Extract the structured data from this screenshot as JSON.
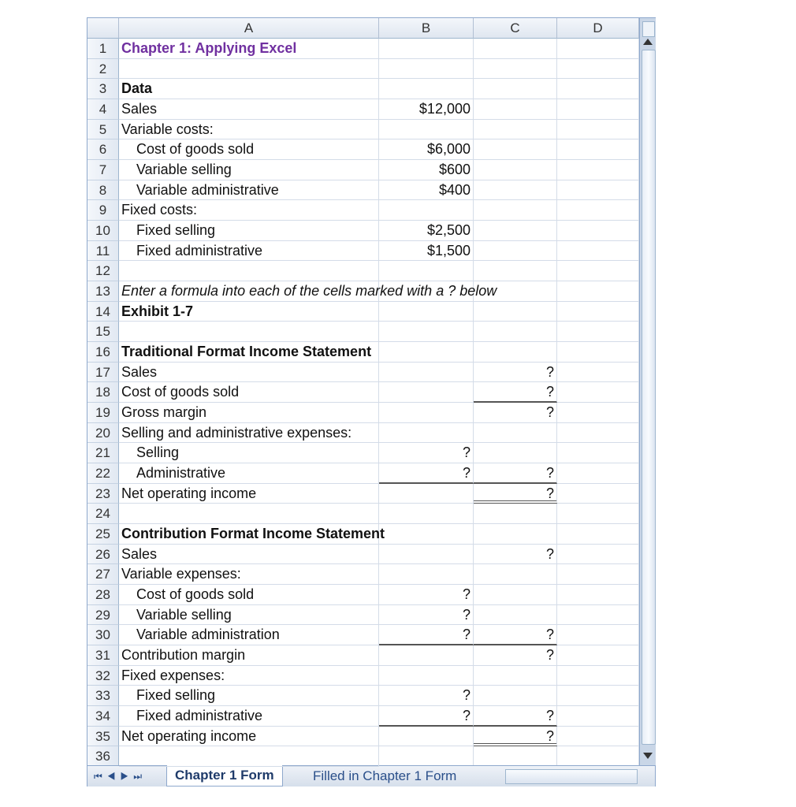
{
  "columns": [
    "A",
    "B",
    "C",
    "D"
  ],
  "rows": [
    {
      "a": "Chapter 1: Applying Excel"
    },
    {},
    {
      "a": "Data"
    },
    {
      "a": "Sales",
      "b": "$12,000"
    },
    {
      "a": "Variable costs:"
    },
    {
      "a": "Cost of goods sold",
      "b": "$6,000"
    },
    {
      "a": "Variable selling",
      "b": "$600"
    },
    {
      "a": "Variable administrative",
      "b": "$400"
    },
    {
      "a": "Fixed costs:"
    },
    {
      "a": "Fixed selling",
      "b": "$2,500"
    },
    {
      "a": "Fixed administrative",
      "b": "$1,500"
    },
    {},
    {
      "a": "Enter a formula into each of the cells marked with a ? below"
    },
    {
      "a": "Exhibit 1-7"
    },
    {},
    {
      "a": "Traditional Format Income Statement"
    },
    {
      "a": "Sales",
      "c": "?"
    },
    {
      "a": "Cost of goods sold",
      "c": "?"
    },
    {
      "a": "Gross margin",
      "c": "?"
    },
    {
      "a": "Selling and administrative expenses:"
    },
    {
      "a": "Selling",
      "b": "?"
    },
    {
      "a": "Administrative",
      "b": "?",
      "c": "?"
    },
    {
      "a": "Net operating income",
      "c": "?"
    },
    {},
    {
      "a": "Contribution Format Income Statement"
    },
    {
      "a": "Sales",
      "c": "?"
    },
    {
      "a": "Variable expenses:"
    },
    {
      "a": "Cost of goods sold",
      "b": "?"
    },
    {
      "a": "Variable selling",
      "b": "?"
    },
    {
      "a": "Variable administration",
      "b": "?",
      "c": "?"
    },
    {
      "a": "Contribution margin",
      "c": "?"
    },
    {
      "a": "Fixed expenses:"
    },
    {
      "a": "Fixed selling",
      "b": "?"
    },
    {
      "a": "Fixed administrative",
      "b": "?",
      "c": "?"
    },
    {
      "a": "Net operating income",
      "c": "?"
    },
    {}
  ],
  "sheet_tabs": [
    {
      "label": "Chapter 1 Form",
      "active": true
    },
    {
      "label": "Filled in Chapter 1 Form",
      "active": false
    }
  ],
  "colors": {
    "title": "#7030a0",
    "header_bg": "#dfe6f0",
    "scrollbar": "#c9d6e7"
  }
}
